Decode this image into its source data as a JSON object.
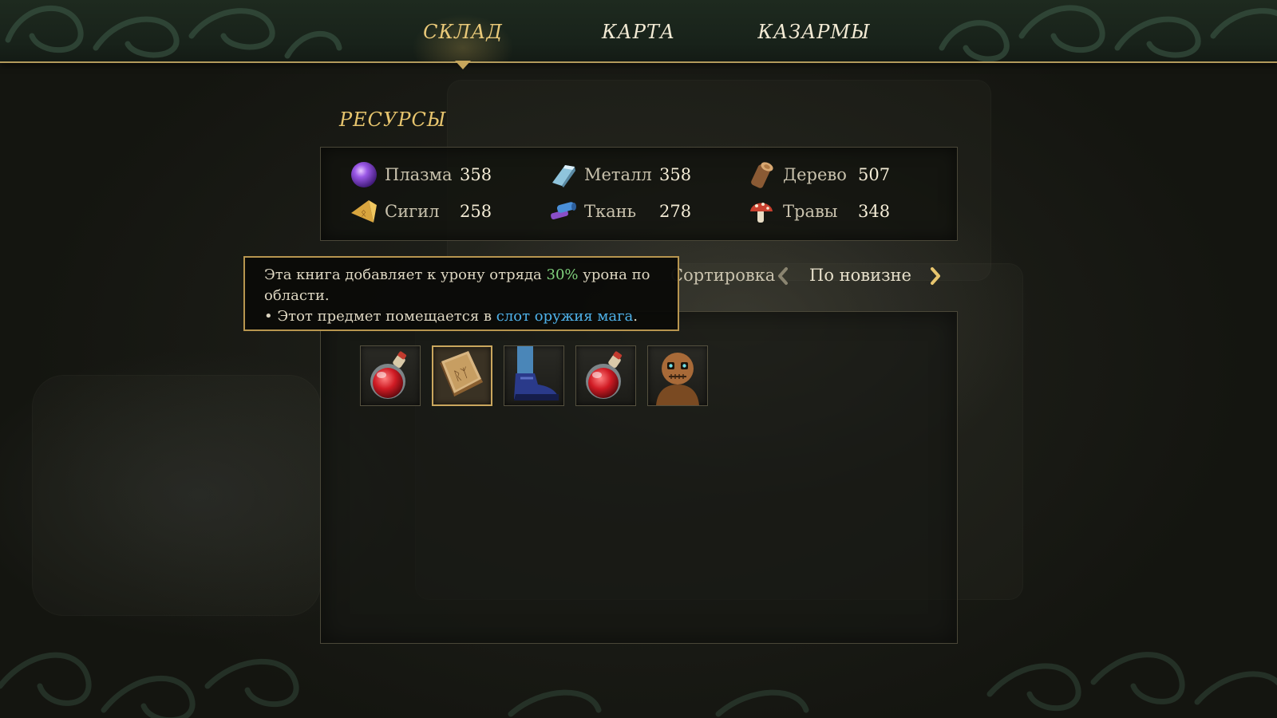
{
  "nav": {
    "tabs": [
      {
        "label": "СКЛАД",
        "active": true
      },
      {
        "label": "КАРТА",
        "active": false
      },
      {
        "label": "КАЗАРМЫ",
        "active": false
      }
    ]
  },
  "resources": {
    "title": "РЕСУРСЫ",
    "items": [
      {
        "name": "Плазма",
        "value": "358",
        "icon": "plasma-orb-icon"
      },
      {
        "name": "Металл",
        "value": "358",
        "icon": "metal-ingot-icon"
      },
      {
        "name": "Дерево",
        "value": "507",
        "icon": "wood-log-icon"
      },
      {
        "name": "Сигил",
        "value": "258",
        "icon": "sigil-icon"
      },
      {
        "name": "Ткань",
        "value": "278",
        "icon": "cloth-roll-icon"
      },
      {
        "name": "Травы",
        "value": "348",
        "icon": "mushroom-herb-icon"
      }
    ]
  },
  "sort": {
    "label": "Сортировка",
    "value": "По новизне"
  },
  "tooltip": {
    "part1": "Эта книга добавляет к урону отряда ",
    "highlight_percent": "30%",
    "part2": " урона по области.",
    "bullet_prefix": "• Этот предмет помещается в ",
    "highlight_slot": "слот оружия мага",
    "bullet_suffix": "."
  },
  "inventory": {
    "items": [
      {
        "icon": "red-potion-icon",
        "selected": false
      },
      {
        "icon": "spellbook-icon",
        "selected": true
      },
      {
        "icon": "boot-icon",
        "selected": false
      },
      {
        "icon": "red-potion-icon",
        "selected": false
      },
      {
        "icon": "scarecrow-doll-icon",
        "selected": false
      }
    ]
  },
  "colors": {
    "accent_gold": "#e7c56e",
    "tooltip_green": "#7fd07c",
    "tooltip_blue": "#4fb2ea"
  }
}
